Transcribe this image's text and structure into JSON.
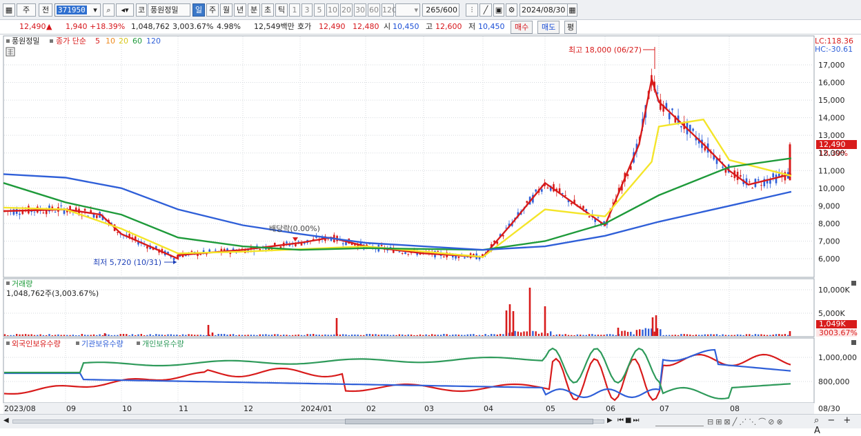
{
  "toolbar": {
    "menu_icon": "grid-icon",
    "type_label": "주",
    "prev_label": "전",
    "stock_code": "371950",
    "stock_name_prefix": "코",
    "stock_name": "풍원정밀",
    "periods": [
      "일",
      "주",
      "월",
      "년",
      "분",
      "초",
      "틱"
    ],
    "selected_period": "일",
    "intervals": [
      "1",
      "3",
      "5",
      "10",
      "20",
      "30",
      "60",
      "120"
    ],
    "count": "265",
    "count_total": "/600",
    "date": "2024/08/30"
  },
  "quote": {
    "price": "12,490",
    "change_arrow": "▲",
    "change": "1,940",
    "change_pct": "+18.39%",
    "volume": "1,048,762",
    "volume_pct": "3,003.67%",
    "turnover_pct": "4.98%",
    "amount": "12,549백만",
    "bid_ask_label": "호가",
    "ask": "12,490",
    "bid": "12,480",
    "open_label": "시",
    "open": "10,450",
    "high_label": "고",
    "high": "12,600",
    "low_label": "저",
    "low": "10,450",
    "buy_button": "매수",
    "sell_button": "매도",
    "eval_button": "평"
  },
  "price_panel": {
    "legend_stock": "풍원정밀",
    "legend_ma_title": "종가 단순",
    "ma_periods": [
      "5",
      "10",
      "20",
      "60",
      "120"
    ],
    "ma_colors": [
      "#d81b1b",
      "#ee8a1e",
      "#f4e52a",
      "#1e9a3a",
      "#2f5fd8"
    ],
    "lc": "LC:118.36",
    "hc": "HC:-30.61",
    "high_annotation": "최고 18,000 (06/27)",
    "low_annotation": "최저 5,720 (10/31)",
    "dividend_annotation": "배당락(0.00%)",
    "current_price_tag": "12,490",
    "current_pct_tag": "18.39%",
    "y_ticks": [
      "17,000",
      "16,000",
      "15,000",
      "14,000",
      "13,000",
      "12,000",
      "11,000",
      "10,000",
      "9,000",
      "8,000",
      "7,000",
      "6,000"
    ]
  },
  "volume_panel": {
    "title": "거래량",
    "value": "1,048,762주(3,003.67%)",
    "y_ticks": [
      "10,000K",
      "5,000K"
    ],
    "current_tag": "1,049K",
    "current_pct_tag": "3003.67%"
  },
  "holding_panel": {
    "series_names": [
      "외국인보유수량",
      "기관보유수량",
      "개인보유수량"
    ],
    "series_colors": [
      "#d81b1b",
      "#2f5fd8",
      "#2e9a5a"
    ],
    "y_ticks": [
      "1,000,000",
      "800,000"
    ]
  },
  "x_axis": {
    "labels": [
      "2023/08",
      "09",
      "10",
      "11",
      "12",
      "2024/01",
      "02",
      "03",
      "04",
      "05",
      "06",
      "07",
      "08"
    ],
    "end_label": "08/30"
  },
  "chart_data": {
    "type": "line",
    "title": "풍원정밀",
    "x_range": [
      "2023/08",
      "2024/08/30"
    ],
    "ylim": [
      5500,
      18000
    ],
    "series": [
      {
        "name": "5",
        "color": "#d81b1b",
        "points": [
          [
            "2023/08",
            8700
          ],
          [
            "2023/09",
            8800
          ],
          [
            "2023/09/20",
            8500
          ],
          [
            "2023/10",
            7400
          ],
          [
            "2023/10/31",
            6000
          ],
          [
            "2023/11",
            6200
          ],
          [
            "2023/12",
            6500
          ],
          [
            "2024/01",
            6900
          ],
          [
            "2024/01/15",
            7200
          ],
          [
            "2024/02",
            6700
          ],
          [
            "2024/03",
            6300
          ],
          [
            "2024/04",
            6100
          ],
          [
            "2024/04/15",
            8000
          ],
          [
            "2024/05",
            10300
          ],
          [
            "2024/06",
            7900
          ],
          [
            "2024/06/20",
            12500
          ],
          [
            "2024/06/27",
            16200
          ],
          [
            "2024/07",
            14900
          ],
          [
            "2024/07/20",
            12500
          ],
          [
            "2024/08",
            11000
          ],
          [
            "2024/08/10",
            10200
          ],
          [
            "2024/08/30",
            10800
          ]
        ]
      },
      {
        "name": "20",
        "color": "#f4e52a",
        "points": [
          [
            "2023/08",
            8900
          ],
          [
            "2023/09",
            8800
          ],
          [
            "2023/10",
            7700
          ],
          [
            "2023/10/31",
            6300
          ],
          [
            "2023/12",
            6400
          ],
          [
            "2024/02",
            6700
          ],
          [
            "2024/04",
            6100
          ],
          [
            "2024/05",
            8800
          ],
          [
            "2024/06",
            8400
          ],
          [
            "2024/06/27",
            11500
          ],
          [
            "2024/07",
            13500
          ],
          [
            "2024/07/20",
            13900
          ],
          [
            "2024/08",
            11600
          ],
          [
            "2024/08/30",
            10700
          ]
        ]
      },
      {
        "name": "60",
        "color": "#1e9a3a",
        "points": [
          [
            "2023/08",
            10300
          ],
          [
            "2023/09",
            9200
          ],
          [
            "2023/10",
            8500
          ],
          [
            "2023/11",
            7200
          ],
          [
            "2023/12",
            6700
          ],
          [
            "2024/01",
            6500
          ],
          [
            "2024/02",
            6600
          ],
          [
            "2024/03",
            6550
          ],
          [
            "2024/04",
            6500
          ],
          [
            "2024/05",
            7000
          ],
          [
            "2024/06",
            8000
          ],
          [
            "2024/07",
            9600
          ],
          [
            "2024/08",
            11200
          ],
          [
            "2024/08/30",
            11700
          ]
        ]
      },
      {
        "name": "120",
        "color": "#2f5fd8",
        "points": [
          [
            "2023/08",
            10800
          ],
          [
            "2023/09",
            10600
          ],
          [
            "2023/10",
            10000
          ],
          [
            "2023/11",
            8800
          ],
          [
            "2023/12",
            7900
          ],
          [
            "2024/01",
            7400
          ],
          [
            "2024/02",
            6900
          ],
          [
            "2024/03",
            6700
          ],
          [
            "2024/04",
            6500
          ],
          [
            "2024/05",
            6700
          ],
          [
            "2024/06",
            7300
          ],
          [
            "2024/07",
            8100
          ],
          [
            "2024/08",
            9000
          ],
          [
            "2024/08/30",
            9800
          ]
        ]
      }
    ],
    "annotations": [
      {
        "label": "최고 18,000 (06/27)",
        "x": "2024/06/27",
        "y": 18000
      },
      {
        "label": "최저 5,720 (10/31)",
        "x": "2023/10/31",
        "y": 5720
      }
    ]
  }
}
